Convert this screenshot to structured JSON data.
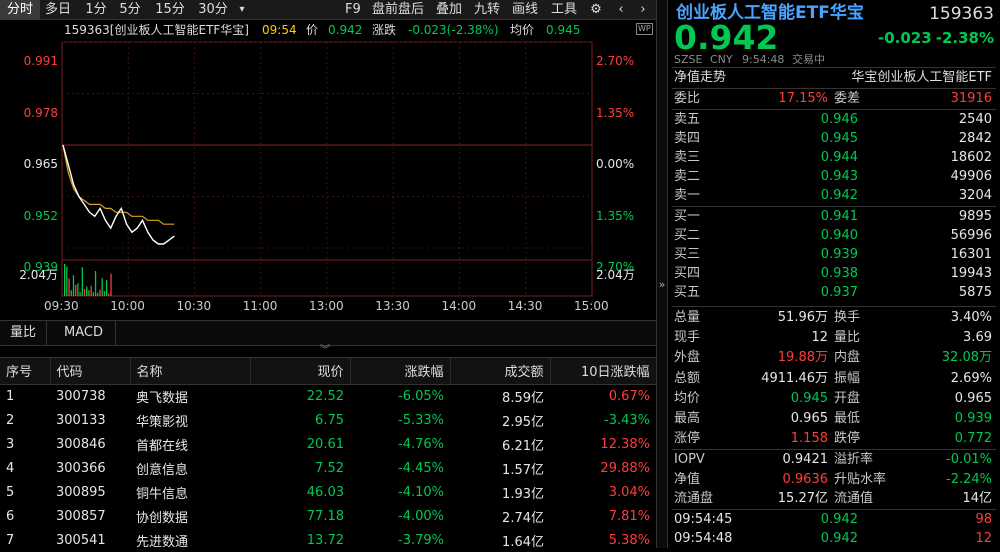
{
  "toolbar": {
    "tabs": [
      "分时",
      "多日",
      "1分",
      "5分",
      "15分",
      "30分"
    ],
    "more_icon": "chevron-down",
    "right": [
      "F9",
      "盘前盘后",
      "叠加",
      "九转",
      "画线",
      "工具"
    ]
  },
  "chart": {
    "info": {
      "code_name": "159363[创业板人工智能ETF华宝]",
      "time": "09:54",
      "price_label": "价",
      "price": "0.942",
      "chg_label": "涨跌",
      "chg": "-0.023(-2.38%)",
      "avg_label": "均价",
      "avg": "0.945"
    },
    "left_ticks": [
      "0.991",
      "0.978",
      "0.965",
      "0.952",
      "0.939"
    ],
    "right_ticks": [
      "2.70%",
      "1.35%",
      "0.00%",
      "1.35%",
      "2.70%"
    ],
    "vol_label": "2.04万",
    "x_ticks": [
      "09:30",
      "10:00",
      "10:30",
      "11:00",
      "13:00",
      "13:30",
      "14:00",
      "14:30",
      "15:00"
    ],
    "ylim": [
      0.939,
      0.991
    ],
    "price_series": [
      0.965,
      0.96,
      0.955,
      0.952,
      0.95,
      0.948,
      0.947,
      0.949,
      0.946,
      0.944,
      0.947,
      0.949,
      0.945,
      0.943,
      0.944,
      0.946,
      0.943,
      0.941,
      0.94,
      0.94,
      0.941,
      0.942
    ],
    "avg_series": [
      0.965,
      0.958,
      0.954,
      0.952,
      0.951,
      0.95,
      0.95,
      0.95,
      0.949,
      0.949,
      0.948,
      0.948,
      0.948,
      0.947,
      0.947,
      0.947,
      0.946,
      0.946,
      0.946,
      0.945,
      0.945,
      0.945
    ],
    "volume_series": [
      1.0,
      0.92,
      0.55,
      0.18,
      0.65,
      0.35,
      0.4,
      0.12,
      0.9,
      0.22,
      0.3,
      0.18,
      0.32,
      0.12,
      0.78,
      0.1,
      0.2,
      0.55,
      0.15,
      0.5,
      0.08,
      0.7
    ],
    "volume_colors": [
      "dn",
      "dn",
      "up",
      "dn",
      "dn",
      "up",
      "dn",
      "dn",
      "dn",
      "up",
      "dn",
      "dn",
      "up",
      "dn",
      "dn",
      "dn",
      "up",
      "dn",
      "dn",
      "dn",
      "up",
      "up"
    ]
  },
  "subtabs": [
    "量比",
    "MACD"
  ],
  "table": {
    "headers": [
      "序号",
      "代码",
      "名称",
      "现价",
      "涨跌幅",
      "成交额",
      "10日涨跌幅"
    ],
    "rows": [
      [
        "1",
        "300738",
        "奥飞数据",
        "22.52",
        "-6.05%",
        "8.59亿",
        "0.67%"
      ],
      [
        "2",
        "300133",
        "华策影视",
        "6.75",
        "-5.33%",
        "2.95亿",
        "-3.43%"
      ],
      [
        "3",
        "300846",
        "首都在线",
        "20.61",
        "-4.76%",
        "6.21亿",
        "12.38%"
      ],
      [
        "4",
        "300366",
        "创意信息",
        "7.52",
        "-4.45%",
        "1.57亿",
        "29.88%"
      ],
      [
        "5",
        "300895",
        "铜牛信息",
        "46.03",
        "-4.10%",
        "1.93亿",
        "3.04%"
      ],
      [
        "6",
        "300857",
        "协创数据",
        "77.18",
        "-4.00%",
        "2.74亿",
        "7.81%"
      ],
      [
        "7",
        "300541",
        "先进数通",
        "13.72",
        "-3.79%",
        "1.64亿",
        "5.38%"
      ]
    ]
  },
  "quote": {
    "name": "创业板人工智能ETF华宝",
    "code": "159363",
    "price": "0.942",
    "chg": "-0.023",
    "pct": "-2.38%",
    "meta": {
      "exchange": "SZSE",
      "currency": "CNY",
      "time": "9:54:48",
      "status": "交易中"
    },
    "nav_label": "净值走势",
    "fund_name": "华宝创业板人工智能ETF",
    "wb": {
      "label": "委比",
      "value": "17.15%",
      "wc_label": "委差",
      "wc_value": "31916"
    },
    "asks": [
      [
        "卖五",
        "0.946",
        "2540"
      ],
      [
        "卖四",
        "0.945",
        "2842"
      ],
      [
        "卖三",
        "0.944",
        "18602"
      ],
      [
        "卖二",
        "0.943",
        "49906"
      ],
      [
        "卖一",
        "0.942",
        "3204"
      ]
    ],
    "bids": [
      [
        "买一",
        "0.941",
        "9895"
      ],
      [
        "买二",
        "0.940",
        "56996"
      ],
      [
        "买三",
        "0.939",
        "16301"
      ],
      [
        "买四",
        "0.938",
        "19943"
      ],
      [
        "买五",
        "0.937",
        "5875"
      ]
    ],
    "stats": [
      [
        "总量",
        "51.96万",
        "",
        "换手",
        "3.40%",
        ""
      ],
      [
        "现手",
        "12",
        "",
        "量比",
        "3.69",
        ""
      ],
      [
        "外盘",
        "19.88万",
        "up",
        "内盘",
        "32.08万",
        "dn"
      ],
      [
        "总额",
        "4911.46万",
        "",
        "振幅",
        "2.69%",
        ""
      ],
      [
        "均价",
        "0.945",
        "dn",
        "开盘",
        "0.965",
        ""
      ],
      [
        "最高",
        "0.965",
        "",
        "最低",
        "0.939",
        "dn"
      ],
      [
        "涨停",
        "1.158",
        "up",
        "跌停",
        "0.772",
        "dn"
      ]
    ],
    "stats2": [
      [
        "IOPV",
        "0.9421",
        "",
        "溢折率",
        "-0.01%",
        "dn"
      ],
      [
        "净值",
        "0.9636",
        "up",
        "升贴水率",
        "-2.24%",
        "dn"
      ],
      [
        "流通盘",
        "15.27亿",
        "",
        "流通值",
        "14亿",
        ""
      ]
    ],
    "ticks": [
      [
        "09:54:45",
        "0.942",
        "98"
      ],
      [
        "09:54:48",
        "0.942",
        "12"
      ]
    ]
  }
}
